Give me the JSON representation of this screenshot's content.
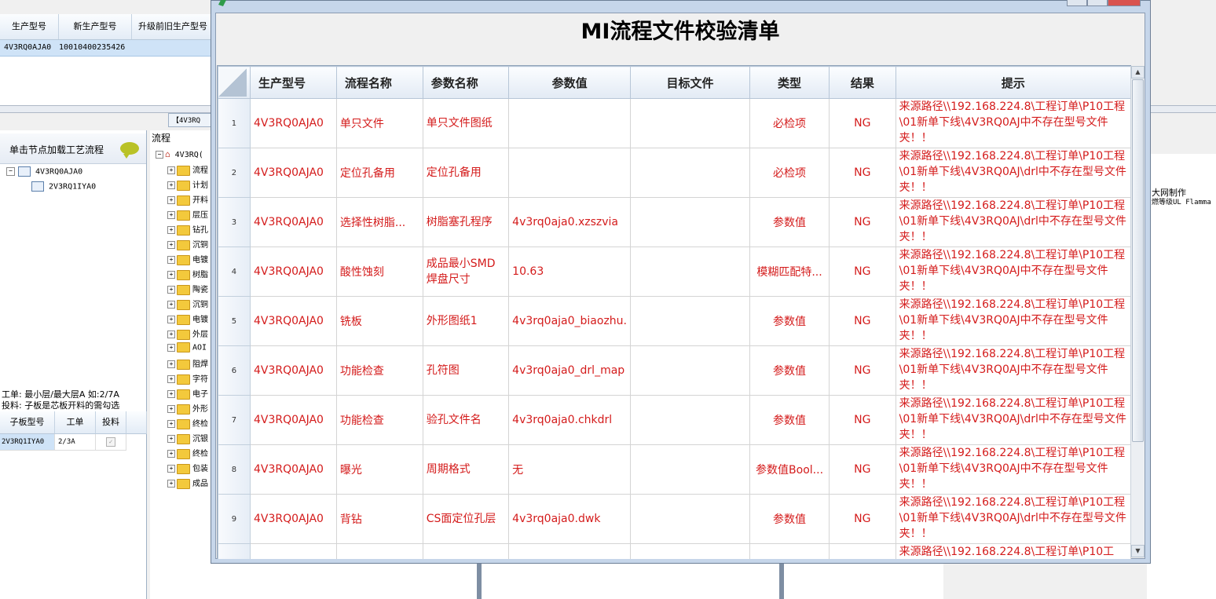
{
  "app": {
    "columns": [
      "生产型号",
      "新生产型号",
      "升级前旧生产型号"
    ],
    "row": {
      "model": "4V3RQ0AJA0",
      "new_model": "10010400235426"
    },
    "left_title": "单击节点加载工艺流程",
    "tree_root": "4V3RQ0AJA0",
    "tree_child": "2V3RQ1IYA0",
    "mid_tab": "【4V3RQ",
    "mid_title": "流程",
    "mid_root": "4V3RQ(",
    "mid_items": [
      "流程",
      "计划",
      "开料",
      "层压",
      "钻孔",
      "沉铜",
      "电镀",
      "树脂",
      "陶瓷",
      "沉铜",
      "电镀",
      "外层",
      "AOI",
      "阻焊",
      "字符",
      "电子",
      "外形",
      "终检",
      "沉银",
      "终检",
      "包装",
      "成品"
    ],
    "note1": "工单: 最小层/最大层A 如:2/7A",
    "note2": "投料: 子板是芯板开料的需勾选",
    "sub_headers": [
      "子板型号",
      "工单",
      "投料"
    ],
    "sub_row": {
      "model": "2V3RQ1IYA0",
      "order": "2/3A"
    },
    "right_text1": "大网制作",
    "right_text2": "燃等级UL Flamma"
  },
  "dialog": {
    "title": "MI流程文件校验清单",
    "headers": [
      "生产型号",
      "流程名称",
      "参数名称",
      "参数值",
      "目标文件",
      "类型",
      "结果",
      "提示"
    ],
    "rows": [
      {
        "idx": "1",
        "model": "4V3RQ0AJA0",
        "flow": "单只文件",
        "param": "单只文件图纸",
        "value": "",
        "target": "",
        "type": "必检项",
        "result": "NG",
        "hint": "来源路径\\\\192.168.224.8\\工程订单\\P10工程\\01新单下线\\4V3RQ0AJ中不存在型号文件夹！！"
      },
      {
        "idx": "2",
        "model": "4V3RQ0AJA0",
        "flow": "定位孔备用",
        "param": "定位孔备用",
        "value": "",
        "target": "",
        "type": "必检项",
        "result": "NG",
        "hint": "来源路径\\\\192.168.224.8\\工程订单\\P10工程\\01新单下线\\4V3RQ0AJ\\drl中不存在型号文件夹！！"
      },
      {
        "idx": "3",
        "model": "4V3RQ0AJA0",
        "flow": "选择性树脂...",
        "param": "树脂塞孔程序",
        "value": "4v3rq0aja0.xzszvia",
        "target": "",
        "type": "参数值",
        "result": "NG",
        "hint": "来源路径\\\\192.168.224.8\\工程订单\\P10工程\\01新单下线\\4V3RQ0AJ\\drl中不存在型号文件夹！！"
      },
      {
        "idx": "4",
        "model": "4V3RQ0AJA0",
        "flow": "酸性蚀刻",
        "param": "成品最小SMD焊盘尺寸",
        "value": "10.63",
        "target": "",
        "type": "模糊匹配特...",
        "result": "NG",
        "hint": "来源路径\\\\192.168.224.8\\工程订单\\P10工程\\01新单下线\\4V3RQ0AJ中不存在型号文件夹！！"
      },
      {
        "idx": "5",
        "model": "4V3RQ0AJA0",
        "flow": "铣板",
        "param": "外形图纸1",
        "value": "4v3rq0aja0_biaozhu.",
        "target": "",
        "type": "参数值",
        "result": "NG",
        "hint": "来源路径\\\\192.168.224.8\\工程订单\\P10工程\\01新单下线\\4V3RQ0AJ中不存在型号文件夹！！"
      },
      {
        "idx": "6",
        "model": "4V3RQ0AJA0",
        "flow": "功能检查",
        "param": "孔符图",
        "value": "4v3rq0aja0_drl_map",
        "target": "",
        "type": "参数值",
        "result": "NG",
        "hint": "来源路径\\\\192.168.224.8\\工程订单\\P10工程\\01新单下线\\4V3RQ0AJ中不存在型号文件夹！！"
      },
      {
        "idx": "7",
        "model": "4V3RQ0AJA0",
        "flow": "功能检查",
        "param": "验孔文件名",
        "value": "4v3rq0aja0.chkdrl",
        "target": "",
        "type": "参数值",
        "result": "NG",
        "hint": "来源路径\\\\192.168.224.8\\工程订单\\P10工程\\01新单下线\\4V3RQ0AJ\\drl中不存在型号文件夹！！"
      },
      {
        "idx": "8",
        "model": "4V3RQ0AJA0",
        "flow": "曝光",
        "param": "周期格式",
        "value": "无",
        "target": "",
        "type": "参数值Bool...",
        "result": "NG",
        "hint": "来源路径\\\\192.168.224.8\\工程订单\\P10工程\\01新单下线\\4V3RQ0AJ中不存在型号文件夹！！"
      },
      {
        "idx": "9",
        "model": "4V3RQ0AJA0",
        "flow": "背钻",
        "param": "CS面定位孔层",
        "value": "4v3rq0aja0.dwk",
        "target": "",
        "type": "参数值",
        "result": "NG",
        "hint": "来源路径\\\\192.168.224.8\\工程订单\\P10工程\\01新单下线\\4V3RQ0AJ\\drl中不存在型号文件夹！！"
      },
      {
        "idx": "",
        "model": "",
        "flow": "",
        "param": "",
        "value": "",
        "target": "",
        "type": "",
        "result": "",
        "hint": "来源路径\\\\192.168.224.8\\工程订单\\P10工"
      }
    ]
  }
}
